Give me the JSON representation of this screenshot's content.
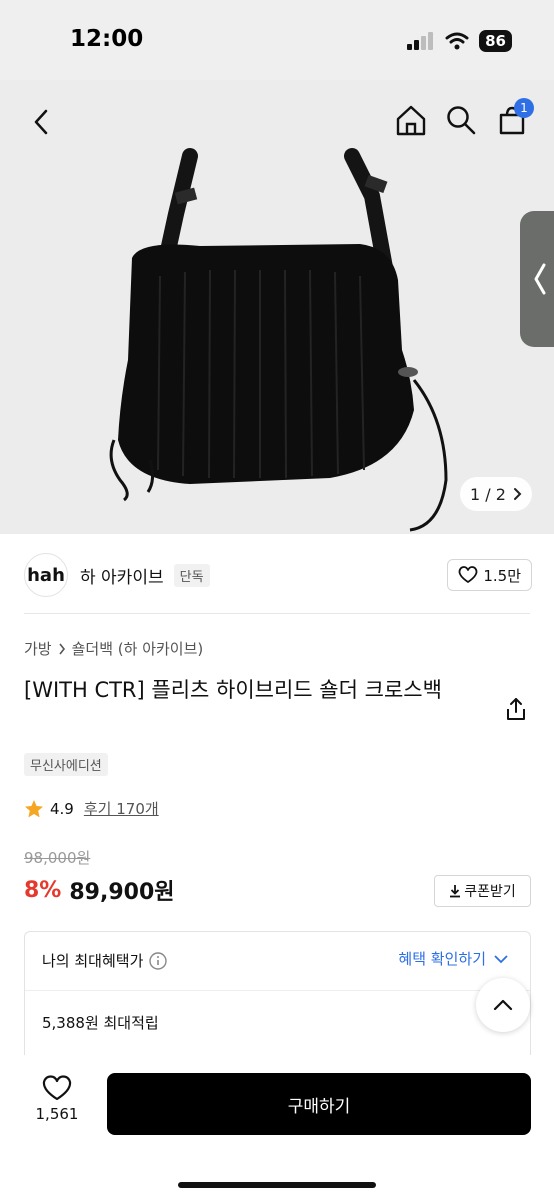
{
  "status": {
    "time": "12:00",
    "battery": "86"
  },
  "nav": {
    "cart_count": "1"
  },
  "gallery": {
    "pager_text": "1 / 2"
  },
  "brand": {
    "logo_text": "hah",
    "name": "하 아카이브",
    "tag": "단독",
    "likes": "1.5만"
  },
  "breadcrumb": {
    "category": "가방",
    "subcategory": "숄더백 (하 아카이브)"
  },
  "product": {
    "title": "[WITH CTR] 플리츠 하이브리드 숄더 크로스백",
    "edition_chip": "무신사에디션",
    "rating": "4.9",
    "reviews": "후기 170개",
    "original_price": "98,000원",
    "discount": "8%",
    "price": "89,900원",
    "coupon_label": "쿠폰받기"
  },
  "benefits": {
    "heading": "나의 최대혜택가",
    "check_label": "혜택 확인하기",
    "points": "5,388원 최대적립"
  },
  "bottom": {
    "wish_count": "1,561",
    "buy_label": "구매하기"
  },
  "colors": {
    "accent_blue": "#2f6fe6",
    "discount_red": "#e5392d",
    "star": "#f5a623"
  }
}
